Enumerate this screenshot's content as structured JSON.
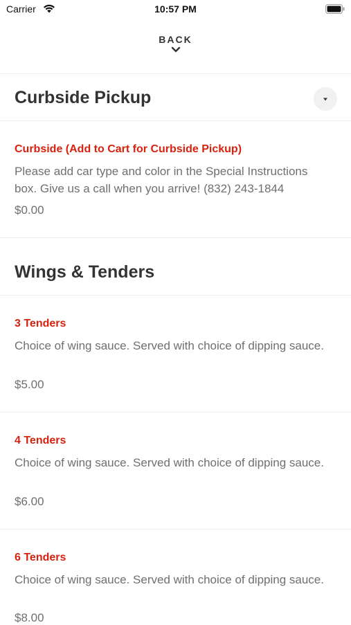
{
  "status_bar": {
    "carrier": "Carrier",
    "time": "10:57 PM"
  },
  "header": {
    "back_label": "BACK"
  },
  "sections": [
    {
      "title": "Curbside Pickup",
      "items": [
        {
          "name": "Curbside (Add to Cart for Curbside Pickup)",
          "description": "Please add car type and color in the Special Instructions box. Give us a call when you arrive! (832) 243-1844",
          "price": "$0.00"
        }
      ]
    },
    {
      "title": "Wings & Tenders",
      "items": [
        {
          "name": "3 Tenders",
          "description": "Choice of wing sauce. Served with choice of dipping sauce.",
          "price": "$5.00"
        },
        {
          "name": "4 Tenders",
          "description": "Choice of wing sauce. Served with choice of dipping sauce.",
          "price": "$6.00"
        },
        {
          "name": "6 Tenders",
          "description": "Choice of wing sauce. Served with choice of dipping sauce.",
          "price": "$8.00"
        }
      ]
    }
  ],
  "colors": {
    "item_name": "#d6220f",
    "text": "#333333",
    "muted": "#6f6f6f",
    "divider": "#ececec"
  },
  "icons": [
    "wifi-icon",
    "battery-icon",
    "chevron-down-icon",
    "dropdown-caret-icon"
  ]
}
